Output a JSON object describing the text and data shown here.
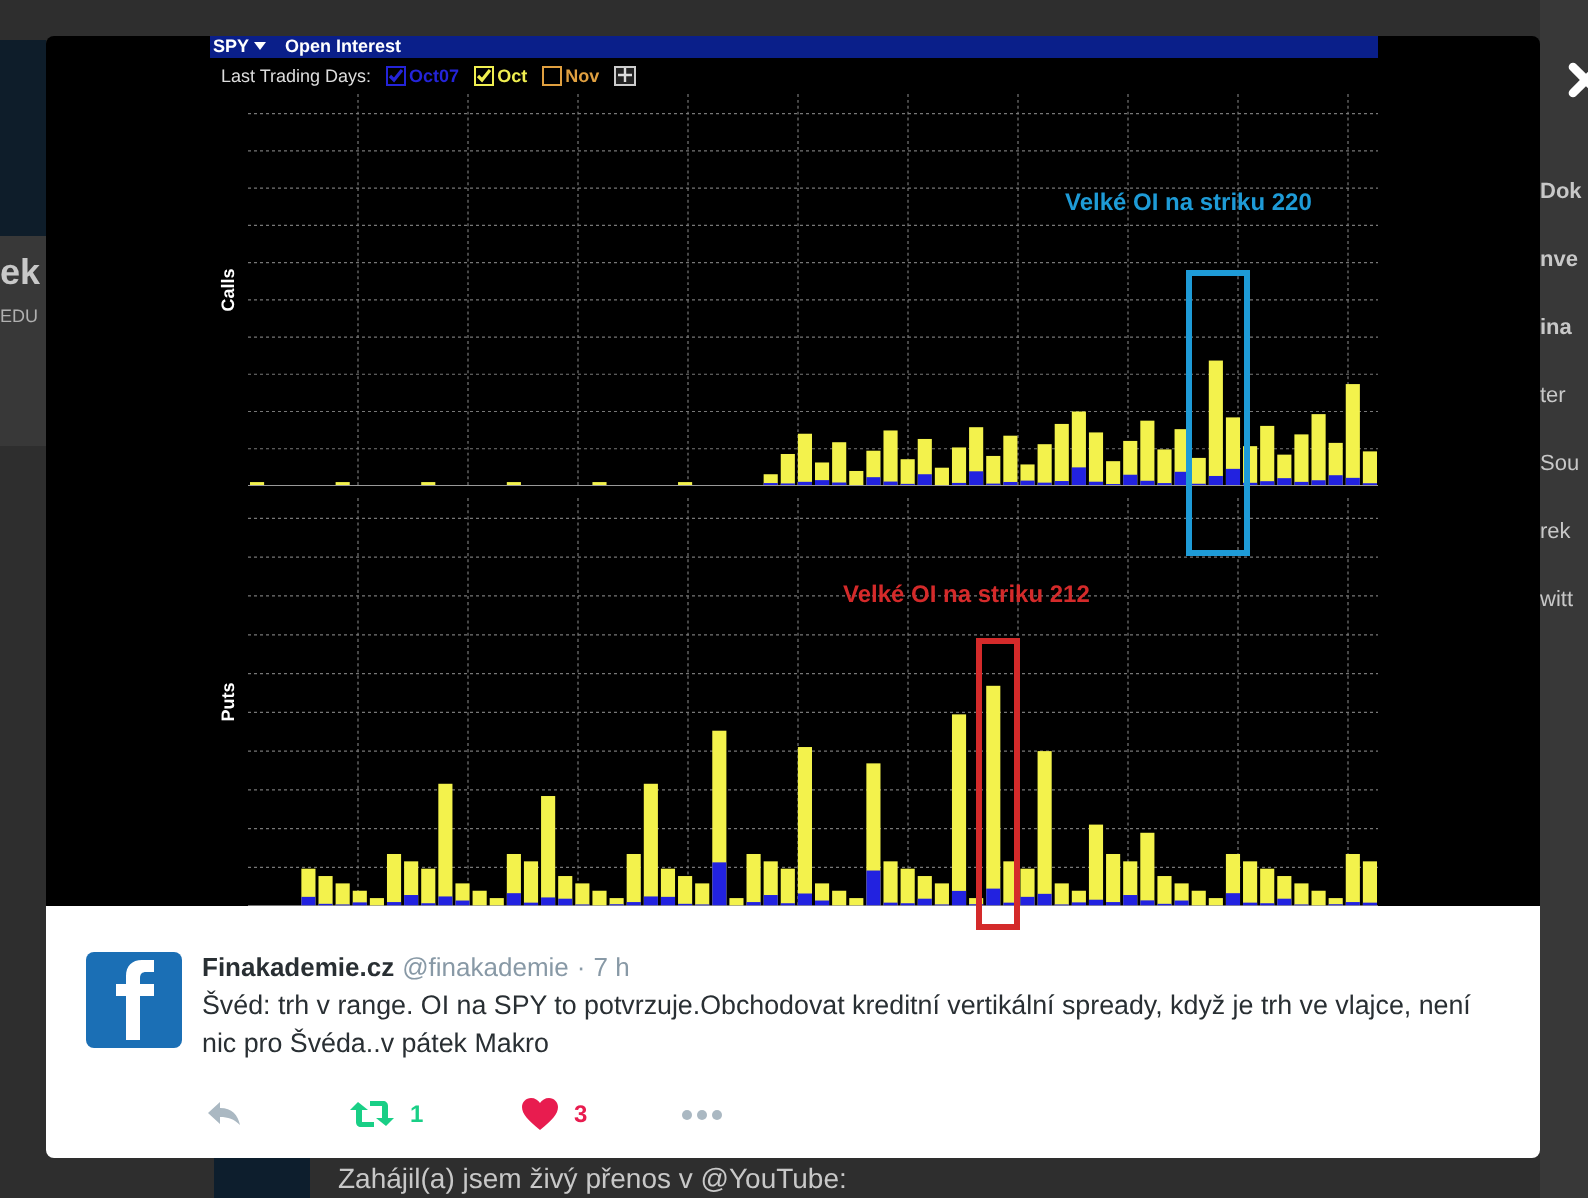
{
  "background": {
    "left_texts": [
      "ek",
      "EDU"
    ],
    "right_texts": [
      "Dok",
      "nve",
      "ina",
      "ter",
      "Sou",
      "rek",
      "witt"
    ],
    "bottom_text": "Zahájil(a) jsem živý přenos v @YouTube:"
  },
  "image": {
    "header": {
      "symbol": "SPY",
      "title": "Open Interest"
    },
    "toolbar": {
      "label": "Last Trading Days:",
      "series": [
        {
          "label": "Oct07",
          "checked": true,
          "color": "#2424d8"
        },
        {
          "label": "Oct",
          "checked": true,
          "color": "#f0ef50"
        },
        {
          "label": "Nov",
          "checked": false,
          "color": "#e0a040"
        }
      ]
    },
    "panels": [
      {
        "kind": "calls",
        "axis_label": "Calls",
        "annotation": "Velké OI na striku 220",
        "color": "#1e9bd7"
      },
      {
        "kind": "puts",
        "axis_label": "Puts",
        "annotation": "Velké OI na striku 212",
        "color": "#d42a2a"
      }
    ]
  },
  "tweet": {
    "name": "Finakademie.cz",
    "handle": "@finakademie",
    "separator": "·",
    "time": "7 h",
    "text": "Švéd: trh v range. OI na SPY to potvrzuje.Obchodovat kreditní vertikální spready, když je trh ve vlajce, není nic pro Švéda..v pátek Makro",
    "retweets": "1",
    "likes": "3"
  }
}
